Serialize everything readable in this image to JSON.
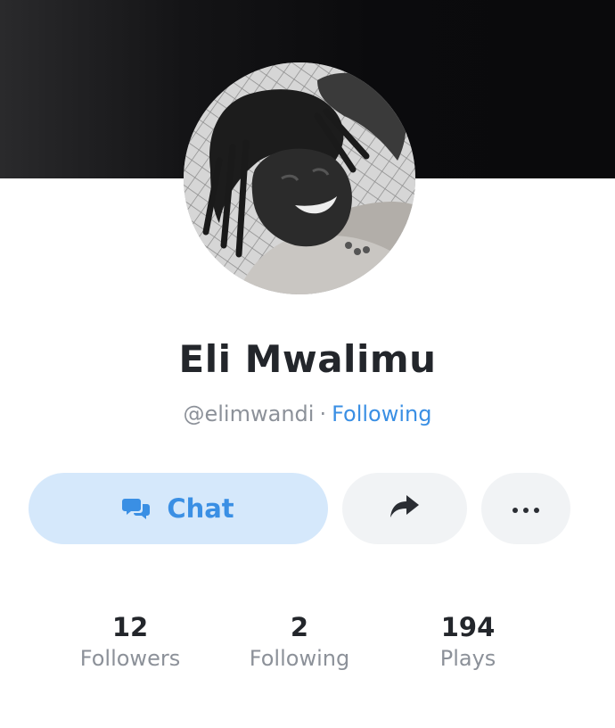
{
  "profile": {
    "name": "Eli Mwalimu",
    "handle": "@elimwandi",
    "separator": "·",
    "follow_status": "Following"
  },
  "actions": {
    "chat_label": "Chat",
    "chat_icon": "chat-bubbles-icon",
    "share_icon": "share-arrow-icon",
    "more_icon": "more-horizontal-icon"
  },
  "stats": [
    {
      "value": "12",
      "label": "Followers"
    },
    {
      "value": "2",
      "label": "Following"
    },
    {
      "value": "194",
      "label": "Plays"
    }
  ],
  "colors": {
    "accent": "#3a8fe4",
    "chat_button_bg": "#d5e8fb",
    "secondary_button_bg": "#f1f3f5",
    "text_primary": "#23262b",
    "text_secondary": "#8c9199",
    "cover": "#0b0b0d"
  }
}
